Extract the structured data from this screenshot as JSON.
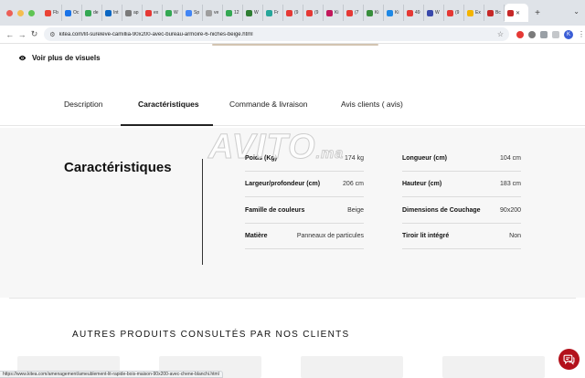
{
  "browser": {
    "tabs": [
      {
        "title": "Fb",
        "favicon_color": "#ea4335"
      },
      {
        "title": "Oc",
        "favicon_color": "#1a73e8"
      },
      {
        "title": "de",
        "favicon_color": "#34a853"
      },
      {
        "title": "Int",
        "favicon_color": "#0a66c2"
      },
      {
        "title": "ap",
        "favicon_color": "#7a7a7a"
      },
      {
        "title": "ex",
        "favicon_color": "#e53935"
      },
      {
        "title": "W",
        "favicon_color": "#34a853"
      },
      {
        "title": "Sp",
        "favicon_color": "#4285f4"
      },
      {
        "title": "ve",
        "favicon_color": "#9e9e9e"
      },
      {
        "title": "12",
        "favicon_color": "#34a853"
      },
      {
        "title": "W",
        "favicon_color": "#2e7d32"
      },
      {
        "title": "Fr",
        "favicon_color": "#26a69a"
      },
      {
        "title": "(9",
        "favicon_color": "#e53935"
      },
      {
        "title": "(9",
        "favicon_color": "#e53935"
      },
      {
        "title": "Ki",
        "favicon_color": "#c2185b"
      },
      {
        "title": "(7",
        "favicon_color": "#e53935"
      },
      {
        "title": "Ki",
        "favicon_color": "#388e3c"
      },
      {
        "title": "Ki",
        "favicon_color": "#1e88e5"
      },
      {
        "title": "49",
        "favicon_color": "#e53935"
      },
      {
        "title": "W",
        "favicon_color": "#3949ab"
      },
      {
        "title": "(9",
        "favicon_color": "#e53935"
      },
      {
        "title": "Ex",
        "favicon_color": "#f4b400"
      },
      {
        "title": "Bc",
        "favicon_color": "#c62828"
      }
    ],
    "active_tab": {
      "title": "",
      "favicon_color": "#c62828"
    },
    "new_tab_label": "+",
    "url": "kitea.com/lit-sureleve-camillia-90x200-avec-bureau-armoire-6-niches-beige.html",
    "profile_initial": "K",
    "status_url": "https://www.kitea.com/amenagement/ameublement-lit-rapide-bois-maison-90x200-avec-chene-blanchi.html"
  },
  "page": {
    "more_visuals": "Voir plus de visuels",
    "tabs": [
      {
        "label": "Description",
        "active": false
      },
      {
        "label": "Caractéristiques",
        "active": true
      },
      {
        "label": "Commande & livraison",
        "active": false
      },
      {
        "label": "Avis clients ( avis)",
        "active": false
      }
    ],
    "features_title": "Caractéristiques",
    "watermark": {
      "main": "AVITO",
      "suffix": ".ma"
    },
    "specs_left": [
      {
        "label": "Poids (Kg)",
        "value": "174 kg"
      },
      {
        "label": "Largeur/profondeur (cm)",
        "value": "206 cm"
      },
      {
        "label": "Famille de couleurs",
        "value": "Beige"
      },
      {
        "label": "Matière",
        "value": "Panneaux de particules"
      }
    ],
    "specs_right": [
      {
        "label": "Longueur (cm)",
        "value": "104 cm"
      },
      {
        "label": "Hauteur (cm)",
        "value": "183 cm"
      },
      {
        "label": "Dimensions de Couchage",
        "value": "90x200"
      },
      {
        "label": "Tiroir lit intégré",
        "value": "Non"
      }
    ],
    "others_title": "AUTRES PRODUITS CONSULTÉS PAR NOS CLIENTS",
    "chat_color": "#b3111b"
  }
}
